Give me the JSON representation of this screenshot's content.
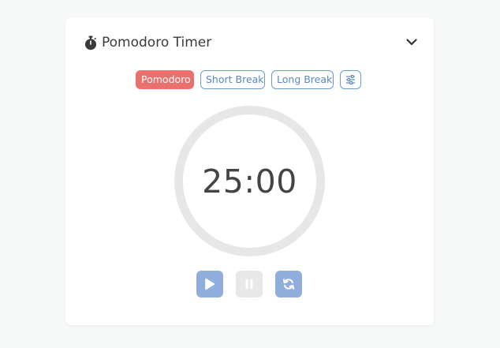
{
  "header": {
    "icon": "stopwatch-icon",
    "title": "Pomodoro Timer",
    "collapse_icon": "chevron-down-icon"
  },
  "modes": [
    {
      "label": "Pomodoro",
      "active": true
    },
    {
      "label": "Short Break",
      "active": false
    },
    {
      "label": "Long Break",
      "active": false
    }
  ],
  "settings_icon": "sliders-icon",
  "timer": {
    "display": "25:00"
  },
  "controls": {
    "play_icon": "play-icon",
    "pause_icon": "pause-icon",
    "pause_disabled": true,
    "reset_icon": "refresh-icon"
  },
  "colors": {
    "accent": "#e9706d",
    "primary": "#6b9acf",
    "button": "#8faedb",
    "ring": "#e7e7e7"
  }
}
